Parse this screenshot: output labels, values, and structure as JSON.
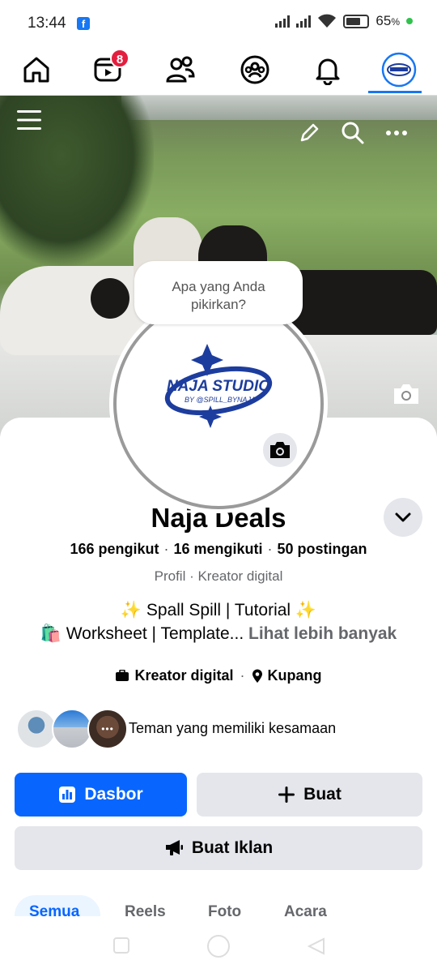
{
  "status_bar": {
    "time": "13:44",
    "battery_percent": "65",
    "battery_suffix": "%"
  },
  "nav": {
    "items": [
      {
        "name": "home",
        "icon": "home-icon"
      },
      {
        "name": "video",
        "icon": "video-icon",
        "badge": "8"
      },
      {
        "name": "friends",
        "icon": "friends-icon"
      },
      {
        "name": "groups",
        "icon": "groups-icon"
      },
      {
        "name": "notifications",
        "icon": "bell-icon"
      },
      {
        "name": "profile",
        "icon": "profile-avatar-icon",
        "active": true
      }
    ]
  },
  "cover": {
    "thought_prompt": "Apa yang Anda pikirkan?"
  },
  "avatar": {
    "logo_line1": "NAJA STUDIO",
    "logo_line2": "BY @SPILL_BYNAJA"
  },
  "profile": {
    "name": "Naja Deals",
    "followers": "166 pengikut",
    "following": "16 mengikuti",
    "posts": "50 postingan",
    "subtitle": "Profil · Kreator digital",
    "bio_line1": "✨ Spall Spill | Tutorial ✨",
    "bio_line2_emoji": "🛍️",
    "bio_line2": " Worksheet | Template...",
    "see_more": " Lihat lebih banyak",
    "category": "Kreator digital",
    "location": "Kupang"
  },
  "mutual": {
    "text": "Teman yang memiliki kesamaan",
    "more_glyph": "•••"
  },
  "buttons": {
    "dashboard": "Dasbor",
    "create": "Buat",
    "create_ad": "Buat Iklan"
  },
  "tabs": [
    "Semua",
    "Reels",
    "Foto",
    "Acara"
  ],
  "colors": {
    "accent": "#0866ff",
    "badge": "#e41e3f",
    "grey_button": "#e4e6eb"
  }
}
